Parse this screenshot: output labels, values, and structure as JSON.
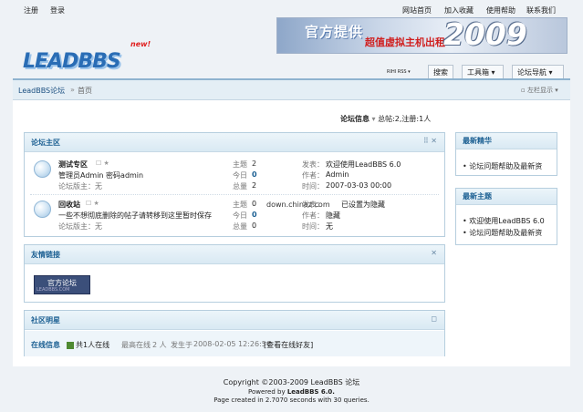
{
  "topbar": {
    "register": "注册",
    "login": "登录",
    "site_home": "网站首页",
    "add_favorite": "加入收藏",
    "help": "使用帮助",
    "contact": "联系我们"
  },
  "banner": {
    "text1": "官方提供",
    "text2": "超值虚拟主机出租",
    "year": "2009"
  },
  "logo": {
    "text": "LEADBBS",
    "badge": "new!"
  },
  "nav": {
    "rss": "RIHI RSS ▾",
    "search": "搜索",
    "toolbox": "工具箱 ▾",
    "forum_nav": "论坛导航 ▾"
  },
  "breadcrumb": {
    "forum": "LeadBBS论坛",
    "sep": "»",
    "home": "首页",
    "left_show": "▫ 左栏显示 ▾"
  },
  "stats": {
    "label": "论坛信息",
    "arrow": "▾",
    "text": "总帖:2,注册:1人"
  },
  "main_area": {
    "title": "论坛主区",
    "forums": [
      {
        "name": "测试专区",
        "icons": "☐ ★",
        "desc": "管理员Admin 密码admin",
        "moderator": "论坛版主：无",
        "topics_label": "主题",
        "topics": "2",
        "today_label": "今日",
        "today": "0",
        "total_label": "总量",
        "total": "2",
        "post_label": "发表：",
        "post": "欢迎使用LeadBBS 6.0",
        "author_label": "作者：",
        "author": "Admin",
        "time_label": "时间：",
        "time": "2007-03-03 00:00"
      },
      {
        "name": "回收站",
        "icons": "☐ ★",
        "desc": "一些不想彻底删除的帖子请转移到这里暂时保存",
        "moderator": "论坛版主：无",
        "topics_label": "主题",
        "topics": "0",
        "today_label": "今日",
        "today": "0",
        "total_label": "总量",
        "total": "0",
        "post_label": "发表：",
        "post": "已设置为隐藏",
        "author_label": "作者：",
        "author": "隐藏",
        "time_label": "时间：",
        "time": "无",
        "overlay": "down.chinaz.com"
      }
    ]
  },
  "links": {
    "title": "友情链接",
    "badge_text": "官方论坛",
    "badge_sub": "LEADBBS.COM"
  },
  "stars": {
    "title": "社区明星"
  },
  "online": {
    "label": "在线信息",
    "count_text": "共1人在线",
    "peak_label": "最高在线",
    "peak": "2 人",
    "when_label": "发生于",
    "when": "2008-02-05 12:26:56",
    "view_button": "[查看在线好友]"
  },
  "sidebar": {
    "hot_title": "最新精华",
    "hot_items": [
      "论坛问题帮助及最新资"
    ],
    "new_title": "最新主题",
    "new_items": [
      "欢迎使用LeadBBS 6.0",
      "论坛问题帮助及最新资"
    ]
  },
  "footer": {
    "copyright": "Copyright ©2003-2009 LeadBBS 论坛",
    "powered_prefix": "Powered by ",
    "powered": "LeadBBS 6.0.",
    "page_created": "Page created in 2.7070 seconds with 30 queries."
  }
}
